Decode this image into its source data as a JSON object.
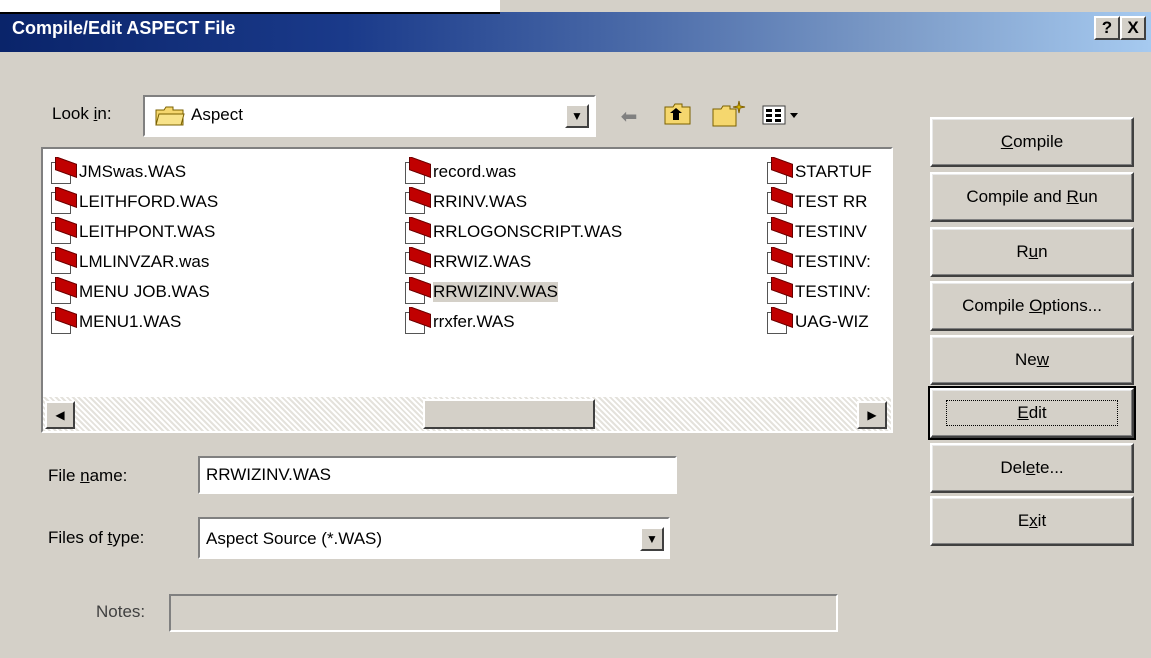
{
  "window": {
    "title": "Compile/Edit ASPECT File",
    "help": "?",
    "close": "X"
  },
  "lookin": {
    "label_pre": "Look ",
    "label_key": "i",
    "label_post": "n:",
    "value": "Aspect"
  },
  "files": {
    "col1": [
      "JMSwas.WAS",
      "LEITHFORD.WAS",
      "LEITHPONT.WAS",
      "LMLINVZAR.was",
      "MENU JOB.WAS",
      "MENU1.WAS"
    ],
    "col2": [
      "record.was",
      "RRINV.WAS",
      "RRLOGONSCRIPT.WAS",
      "RRWIZ.WAS",
      "RRWIZINV.WAS",
      "rrxfer.WAS"
    ],
    "col3": [
      "STARTUF",
      "TEST RR",
      "TESTINV",
      "TESTINV:",
      "TESTINV:",
      "UAG-WIZ"
    ],
    "selected": "RRWIZINV.WAS"
  },
  "filename": {
    "label_pre": "File ",
    "label_key": "n",
    "label_post": "ame:",
    "value": "RRWIZINV.WAS"
  },
  "filetype": {
    "label_pre": "Files of ",
    "label_key": "t",
    "label_post": "ype:",
    "value": "Aspect Source (*.WAS)"
  },
  "notes": {
    "label": "Notes:",
    "value": ""
  },
  "buttons": {
    "compile": {
      "pre": "",
      "key": "C",
      "post": "ompile"
    },
    "compile_run": {
      "pre": "Compile and ",
      "key": "R",
      "post": "un"
    },
    "run": {
      "pre": "R",
      "key": "u",
      "post": "n"
    },
    "options": {
      "pre": "Compile ",
      "key": "O",
      "post": "ptions..."
    },
    "new": {
      "pre": "Ne",
      "key": "w",
      "post": ""
    },
    "edit": {
      "pre": "",
      "key": "E",
      "post": "dit"
    },
    "delete": {
      "pre": "Del",
      "key": "e",
      "post": "te..."
    },
    "exit": {
      "pre": "E",
      "key": "x",
      "post": "it"
    }
  }
}
